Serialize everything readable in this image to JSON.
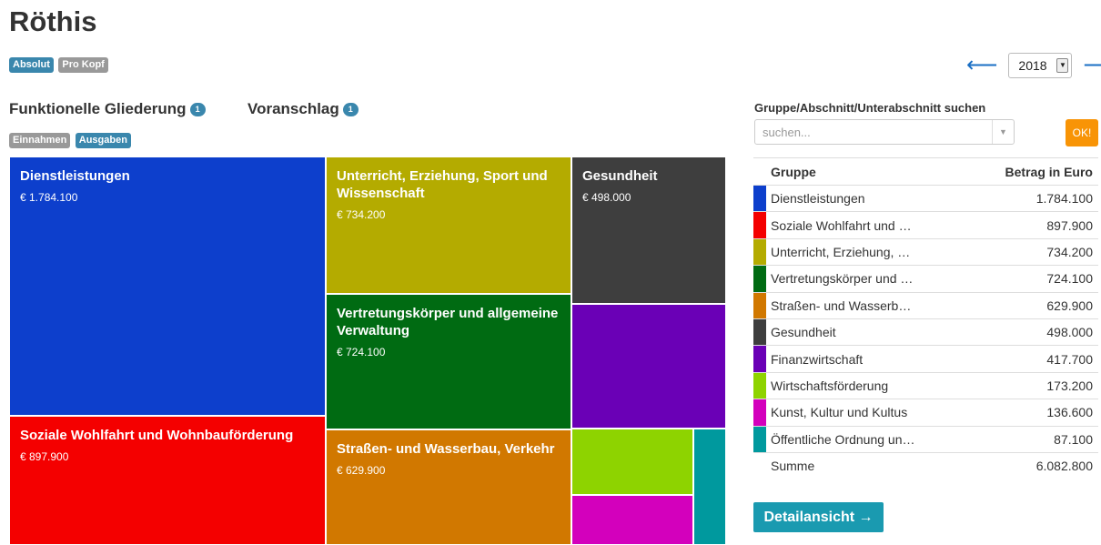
{
  "title": "Röthis",
  "toggle_view": {
    "active": "Absolut",
    "inactive": "Pro Kopf"
  },
  "subtitle_left": {
    "text": "Funktionelle Gliederung",
    "badge": "1"
  },
  "subtitle_right": {
    "text": "Voranschlag",
    "badge": "1"
  },
  "toggle_type": {
    "inactive": "Einnahmen",
    "active": "Ausgaben"
  },
  "year": {
    "value": "2018",
    "prev": "⟵",
    "next": "⟶"
  },
  "search": {
    "label": "Gruppe/Abschnitt/Unterabschnitt suchen",
    "placeholder": "suchen...",
    "ok_label": "OK!"
  },
  "table": {
    "header_group": "Gruppe",
    "header_amount": "Betrag in Euro",
    "rows": [
      {
        "name": "Dienstleistungen",
        "amount": "1.784.100",
        "color": "#0d3fcc"
      },
      {
        "name": "Soziale Wohlfahrt und …",
        "amount": "897.900",
        "color": "#f40000"
      },
      {
        "name": "Unterricht, Erziehung, …",
        "amount": "734.200",
        "color": "#b4ab00"
      },
      {
        "name": "Vertretungskörper und …",
        "amount": "724.100",
        "color": "#006b12"
      },
      {
        "name": "Straßen- und Wasserb…",
        "amount": "629.900",
        "color": "#d17800"
      },
      {
        "name": "Gesundheit",
        "amount": "498.000",
        "color": "#3e3e3e"
      },
      {
        "name": "Finanzwirtschaft",
        "amount": "417.700",
        "color": "#6a00b6"
      },
      {
        "name": "Wirtschaftsförderung",
        "amount": "173.200",
        "color": "#8ed300"
      },
      {
        "name": "Kunst, Kultur und Kultus",
        "amount": "136.600",
        "color": "#d300bc"
      },
      {
        "name": "Öffentliche Ordnung un…",
        "amount": "87.100",
        "color": "#00999e"
      }
    ],
    "sum_label": "Summe",
    "sum_amount": "6.082.800"
  },
  "detail_button": "Detailansicht →",
  "chart_data": {
    "type": "treemap",
    "categories": [
      "Dienstleistungen",
      "Soziale Wohlfahrt und Wohnbauförderung",
      "Unterricht, Erziehung, Sport und Wissenschaft",
      "Vertretungskörper und allgemeine Verwaltung",
      "Straßen- und Wasserbau, Verkehr",
      "Gesundheit",
      "Finanzwirtschaft",
      "Wirtschaftsförderung",
      "Kunst, Kultur und Kultus",
      "Öffentliche Ordnung und Sicherheit"
    ],
    "values": [
      1784100,
      897900,
      734200,
      724100,
      629900,
      498000,
      417700,
      173200,
      136600,
      87100
    ],
    "value_labels": [
      "€ 1.784.100",
      "€ 897.900",
      "€ 734.200",
      "€ 724.100",
      "€ 629.900",
      "€ 498.000",
      "",
      "",
      "",
      ""
    ],
    "display_names": [
      "Dienstleistungen",
      "Soziale Wohlfahrt und Wohnbauförderung",
      "Unterricht, Erziehung, Sport und Wissenschaft",
      "Vertretungskörper und allgemeine Verwaltung",
      "Straßen- und Wasserbau, Verkehr",
      "Gesundheit",
      "",
      "",
      "",
      ""
    ],
    "colors": [
      "#0d3fcc",
      "#f40000",
      "#b4ab00",
      "#006b12",
      "#d17800",
      "#3e3e3e",
      "#6a00b6",
      "#8ed300",
      "#d300bc",
      "#00999e"
    ]
  }
}
